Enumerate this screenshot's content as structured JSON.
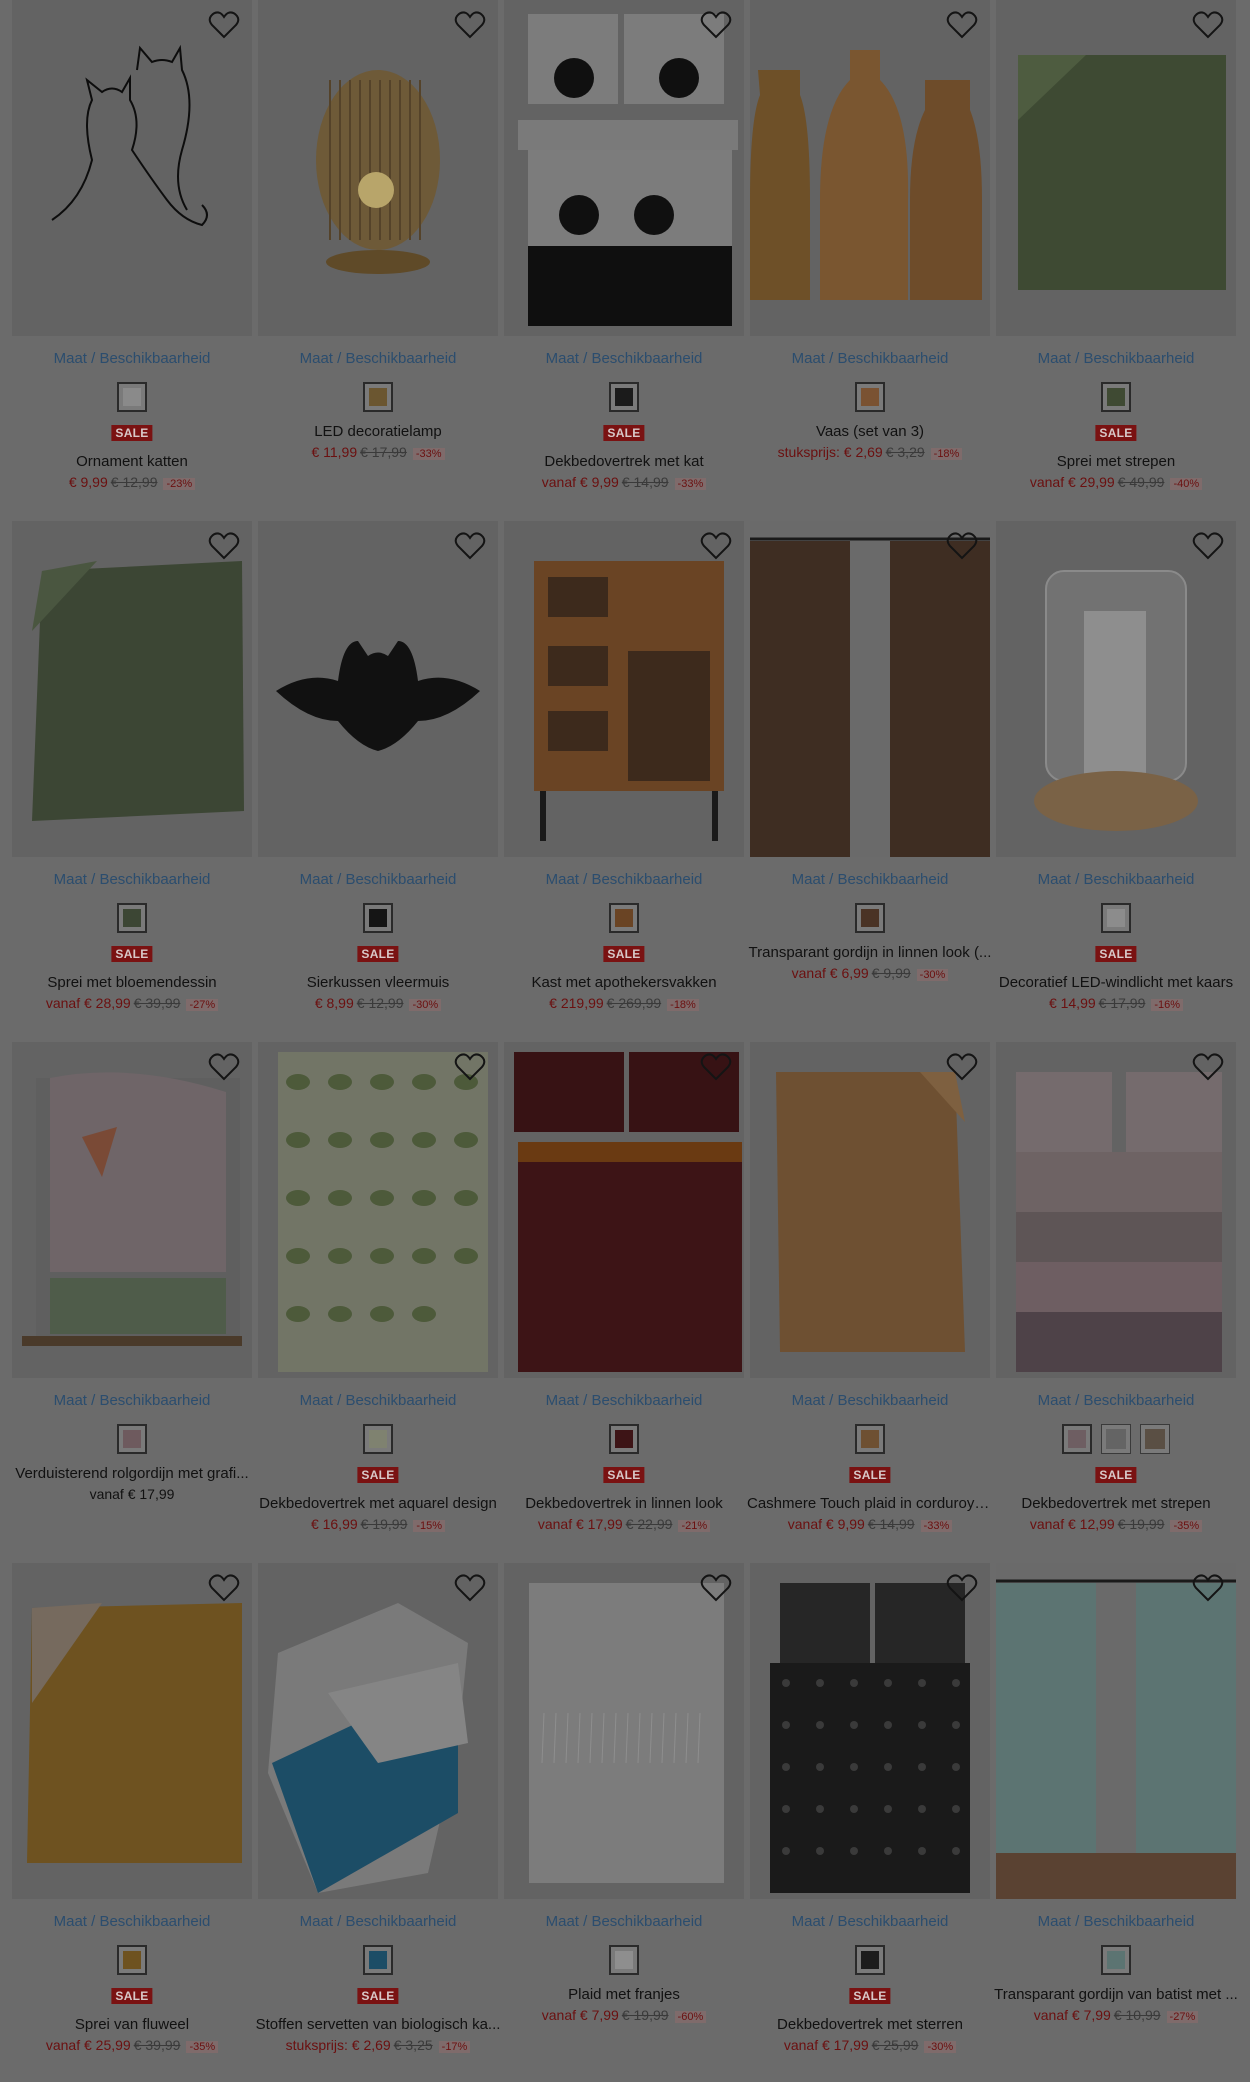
{
  "common": {
    "size_link": "Maat / Beschikbaarheid",
    "sale_badge": "SALE"
  },
  "colors": {
    "page_bg": "#6b6b6b",
    "tile_bg": "#636363",
    "link": "#2b4d6e",
    "sale_red": "#7a1212",
    "price_red": "#6b1010"
  },
  "products": [
    {
      "name": "Ornament katten",
      "sale": true,
      "prefix": "",
      "price": "€ 9,99",
      "orig": "€ 12,99",
      "disc": "-23%",
      "art": "cats-line",
      "swatches": [
        "#8a8a8a"
      ]
    },
    {
      "name": "LED decoratielamp",
      "sale": false,
      "prefix": "",
      "price": "€ 11,99",
      "orig": "€ 17,99",
      "disc": "-33%",
      "art": "lamp",
      "swatches": [
        "#6b5630"
      ]
    },
    {
      "name": "Dekbedovertrek met kat",
      "sale": true,
      "prefix": "vanaf ",
      "price": "€ 9,99",
      "orig": "€ 14,99",
      "disc": "-33%",
      "art": "cat-bed",
      "swatches": [
        "#1b1b1b"
      ]
    },
    {
      "name": "Vaas (set van 3)",
      "sale": false,
      "prefix": "stuksprijs: ",
      "price": "€ 2,69",
      "orig": "€ 3,29",
      "disc": "-18%",
      "art": "vases",
      "swatches": [
        "#7a5232"
      ]
    },
    {
      "name": "Sprei met strepen",
      "sale": true,
      "prefix": "vanaf ",
      "price": "€ 29,99",
      "orig": "€ 49,99",
      "disc": "-40%",
      "art": "green-spread",
      "swatches": [
        "#3f4a33"
      ]
    },
    {
      "name": "Sprei met bloemendessin",
      "sale": true,
      "prefix": "vanaf ",
      "price": "€ 28,99",
      "orig": "€ 39,99",
      "disc": "-27%",
      "art": "green-quilt",
      "swatches": [
        "#3c4634"
      ]
    },
    {
      "name": "Sierkussen vleermuis",
      "sale": true,
      "prefix": "",
      "price": "€ 8,99",
      "orig": "€ 12,99",
      "disc": "-30%",
      "art": "bat",
      "swatches": [
        "#151515"
      ]
    },
    {
      "name": "Kast met apothekersvakken",
      "sale": true,
      "prefix": "",
      "price": "€ 219,99",
      "orig": "€ 269,99",
      "disc": "-18%",
      "art": "cabinet",
      "swatches": [
        "#6a4424"
      ]
    },
    {
      "name": "Transparant gordijn in linnen look (...",
      "sale": false,
      "prefix": "vanaf ",
      "price": "€ 6,99",
      "orig": "€ 9,99",
      "disc": "-30%",
      "art": "brown-curtain",
      "swatches": [
        "#4a3325"
      ]
    },
    {
      "name": "Decoratief LED-windlicht met kaars",
      "sale": true,
      "prefix": "",
      "price": "€ 14,99",
      "orig": "€ 17,99",
      "disc": "-16%",
      "art": "candle",
      "swatches": [
        "#8c8c8c"
      ]
    },
    {
      "name": "Verduisterend rolgordijn met grafi...",
      "sale": false,
      "prefix": "vanaf ",
      "price": "€ 17,99",
      "orig": "",
      "disc": "",
      "art": "blind",
      "swatches": [
        "#6e5a5e"
      ]
    },
    {
      "name": "Dekbedovertrek met aquarel design",
      "sale": true,
      "prefix": "",
      "price": "€ 16,99",
      "orig": "€ 19,99",
      "disc": "-15%",
      "art": "floral-bed",
      "swatches": [
        "#7f8270"
      ]
    },
    {
      "name": "Dekbedovertrek in linnen look",
      "sale": true,
      "prefix": "vanaf ",
      "price": "€ 17,99",
      "orig": "€ 22,99",
      "disc": "-21%",
      "art": "wine-bed",
      "swatches": [
        "#3d1416"
      ]
    },
    {
      "name": "Cashmere Touch plaid in corduroy l...",
      "sale": true,
      "prefix": "vanaf ",
      "price": "€ 9,99",
      "orig": "€ 14,99",
      "disc": "-33%",
      "art": "plaid",
      "swatches": [
        "#6e5032"
      ]
    },
    {
      "name": "Dekbedovertrek met strepen",
      "sale": true,
      "prefix": "vanaf ",
      "price": "€ 12,99",
      "orig": "€ 19,99",
      "disc": "-35%",
      "art": "pink-bed",
      "swatches": [
        "#6e5e62",
        "#646464",
        "#5a4f44"
      ]
    },
    {
      "name": "Sprei van fluweel",
      "sale": true,
      "prefix": "vanaf ",
      "price": "€ 25,99",
      "orig": "€ 39,99",
      "disc": "-35%",
      "art": "mustard-quilt",
      "swatches": [
        "#6e5220"
      ]
    },
    {
      "name": "Stoffen servetten van biologisch ka...",
      "sale": true,
      "prefix": "stuksprijs: ",
      "price": "€ 2,69",
      "orig": "€ 3,25",
      "disc": "-17%",
      "art": "napkins",
      "swatches": [
        "#1c4d66"
      ]
    },
    {
      "name": "Plaid met franjes",
      "sale": false,
      "prefix": "vanaf ",
      "price": "€ 7,99",
      "orig": "€ 19,99",
      "disc": "-60%",
      "art": "white-plaid",
      "swatches": [
        "#8e8e8e"
      ]
    },
    {
      "name": "Dekbedovertrek met sterren",
      "sale": true,
      "prefix": "vanaf ",
      "price": "€ 17,99",
      "orig": "€ 25,99",
      "disc": "-30%",
      "art": "star-bed",
      "swatches": [
        "#1c1c1c"
      ]
    },
    {
      "name": "Transparant gordijn van batist met ...",
      "sale": false,
      "prefix": "vanaf ",
      "price": "€ 7,99",
      "orig": "€ 10,99",
      "disc": "-27%",
      "art": "mint-curtain",
      "swatches": [
        "#5c7472"
      ]
    }
  ]
}
